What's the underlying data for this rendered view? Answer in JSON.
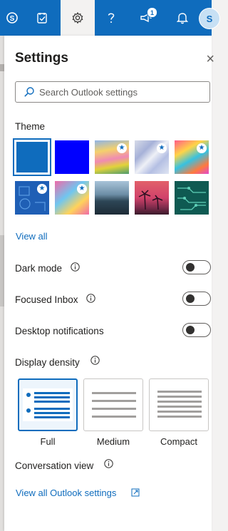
{
  "topbar": {
    "buttons": [
      {
        "name": "skype-icon"
      },
      {
        "name": "todo-icon"
      },
      {
        "name": "gear-icon",
        "active": true
      },
      {
        "name": "help-icon"
      },
      {
        "name": "megaphone-icon",
        "badge": "1"
      },
      {
        "name": "bell-icon"
      }
    ],
    "avatar_initial": "S"
  },
  "settings": {
    "title": "Settings",
    "close_glyph": "×",
    "search_placeholder": "Search Outlook settings",
    "theme_label": "Theme",
    "themes": [
      {
        "name": "theme-blue",
        "selected": true
      },
      {
        "name": "theme-bright-blue"
      },
      {
        "name": "theme-rainbow-waves",
        "star": true
      },
      {
        "name": "theme-silver-ribbons",
        "star": true
      },
      {
        "name": "theme-colorful-art",
        "star": true
      },
      {
        "name": "theme-blue-pattern",
        "star": true
      },
      {
        "name": "theme-puzzle",
        "star": true
      },
      {
        "name": "theme-mountains"
      },
      {
        "name": "theme-palms"
      },
      {
        "name": "theme-circuit"
      }
    ],
    "view_all_themes": "View all",
    "dark_mode": "Dark mode",
    "focused_inbox": "Focused Inbox",
    "desktop_notifications": "Desktop notifications",
    "display_density": "Display density",
    "density_options": [
      "Full",
      "Medium",
      "Compact"
    ],
    "density_selected": "Full",
    "conversation_view": "Conversation view",
    "view_all_settings": "View all Outlook settings"
  },
  "colors": {
    "brand": "#0f6cbd",
    "bright_blue": "#0000ff"
  }
}
